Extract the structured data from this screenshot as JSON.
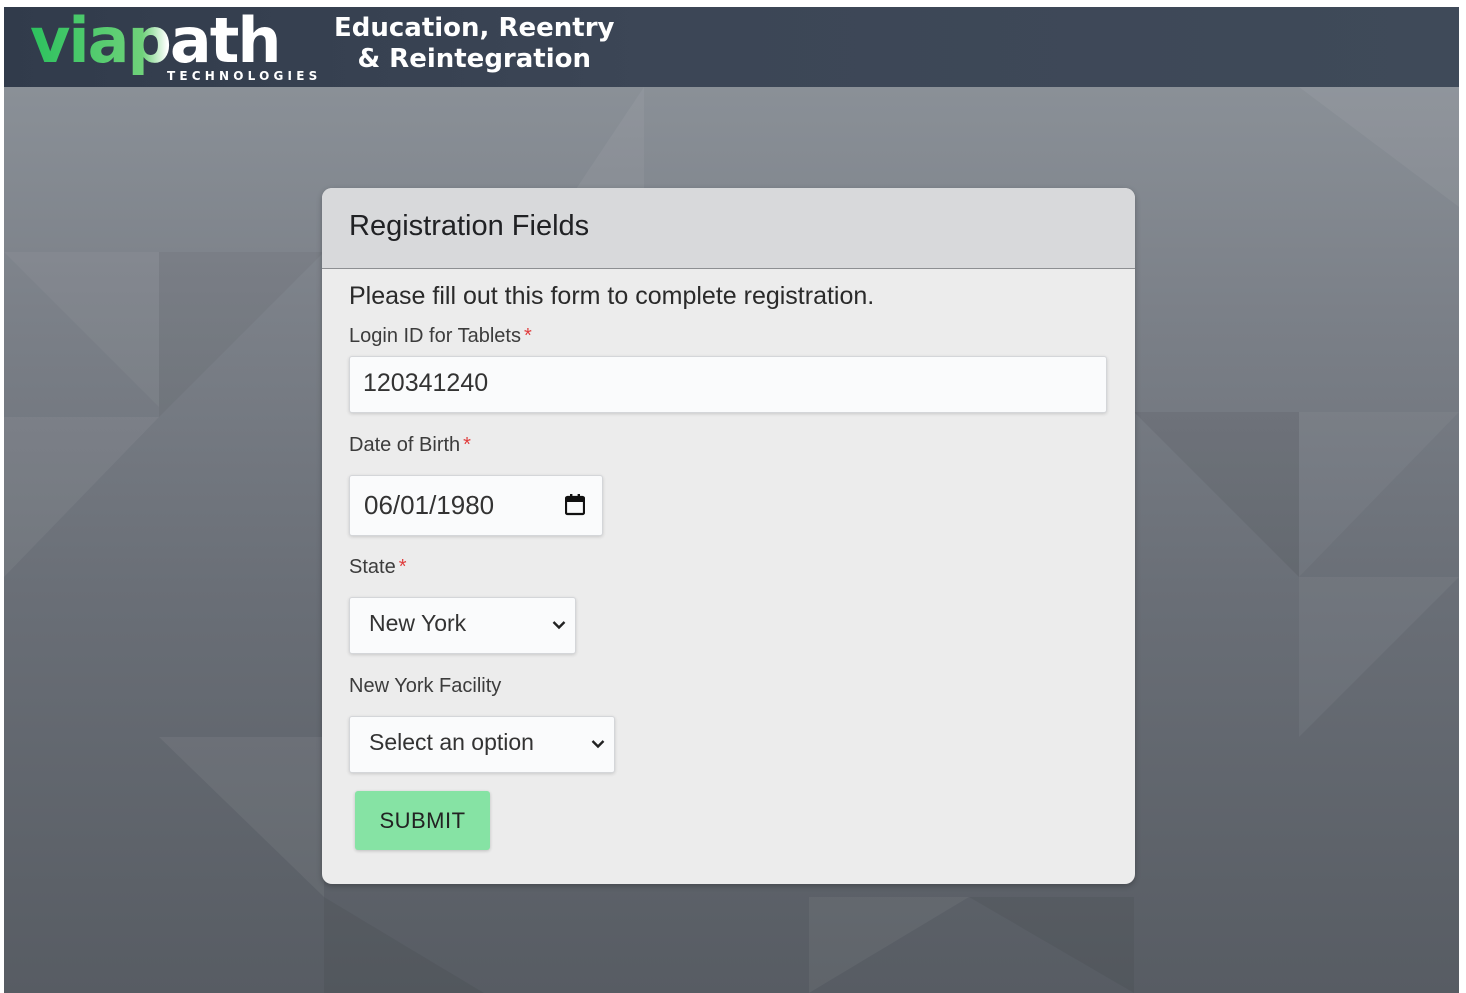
{
  "header": {
    "logo_text": "viapath",
    "logo_subtext": "TECHNOLOGIES",
    "tagline_line1": "Education, Reentry",
    "tagline_line2": "& Reintegration"
  },
  "form": {
    "title": "Registration Fields",
    "intro": "Please fill out this form to complete registration.",
    "required_marker": "*",
    "login_id": {
      "label": "Login ID for Tablets",
      "value": "120341240"
    },
    "dob": {
      "label": "Date of Birth",
      "value": "06/01/1980"
    },
    "state": {
      "label": "State",
      "value": "New York"
    },
    "facility": {
      "label": "New York Facility",
      "value": "Select an option"
    },
    "submit_label": "SUBMIT"
  },
  "colors": {
    "header_bg": "#3a4453",
    "brand_green": "#2cc15e",
    "submit_bg": "#86e3a4",
    "required": "#e03c3c"
  },
  "icons": {
    "date_picker": "calendar-icon",
    "select_arrow": "chevron-down-icon"
  }
}
